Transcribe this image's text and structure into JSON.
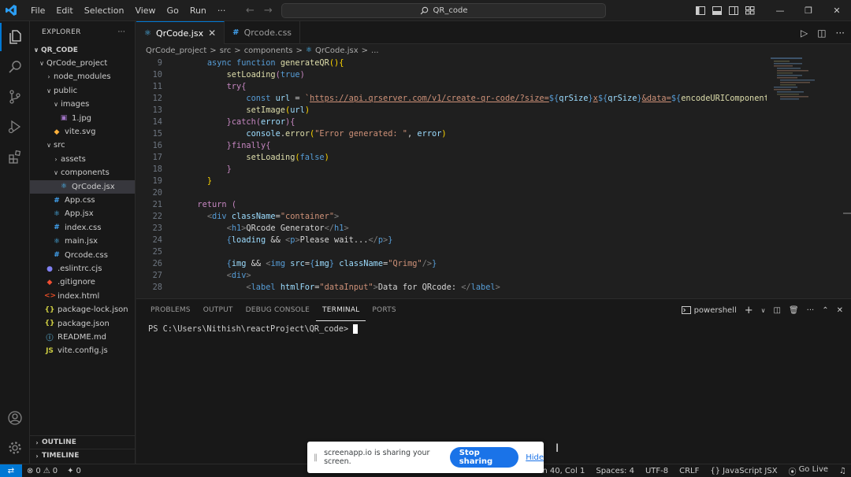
{
  "titlebar": {
    "menu": [
      "File",
      "Edit",
      "Selection",
      "View",
      "Go",
      "Run",
      "···"
    ],
    "search_text": "QR_code",
    "window_controls": [
      "minimize",
      "restore",
      "close"
    ]
  },
  "sidebar": {
    "title": "EXPLORER",
    "more": "···",
    "workspace": "QR_CODE",
    "tree": [
      {
        "label": "QrCode_project",
        "type": "folder-open",
        "indent": 1
      },
      {
        "label": "node_modules",
        "type": "folder-closed",
        "indent": 2
      },
      {
        "label": "public",
        "type": "folder-open",
        "indent": 2
      },
      {
        "label": "images",
        "type": "folder-open",
        "indent": 3
      },
      {
        "label": "1.jpg",
        "type": "image",
        "indent": 4
      },
      {
        "label": "vite.svg",
        "type": "svg",
        "indent": 3
      },
      {
        "label": "src",
        "type": "folder-open",
        "indent": 2
      },
      {
        "label": "assets",
        "type": "folder-closed",
        "indent": 3
      },
      {
        "label": "components",
        "type": "folder-open",
        "indent": 3
      },
      {
        "label": "QrCode.jsx",
        "type": "jsx",
        "indent": 4,
        "selected": true
      },
      {
        "label": "App.css",
        "type": "css",
        "indent": 3
      },
      {
        "label": "App.jsx",
        "type": "jsx",
        "indent": 3
      },
      {
        "label": "index.css",
        "type": "css",
        "indent": 3
      },
      {
        "label": "main.jsx",
        "type": "jsx",
        "indent": 3
      },
      {
        "label": "Qrcode.css",
        "type": "css",
        "indent": 3
      },
      {
        "label": ".eslintrc.cjs",
        "type": "eslint",
        "indent": 2
      },
      {
        "label": ".gitignore",
        "type": "git",
        "indent": 2
      },
      {
        "label": "index.html",
        "type": "html",
        "indent": 2
      },
      {
        "label": "package-lock.json",
        "type": "json",
        "indent": 2
      },
      {
        "label": "package.json",
        "type": "json",
        "indent": 2
      },
      {
        "label": "README.md",
        "type": "md",
        "indent": 2
      },
      {
        "label": "vite.config.js",
        "type": "js",
        "indent": 2
      }
    ],
    "outline": "OUTLINE",
    "timeline": "TIMELINE"
  },
  "tabs": [
    {
      "label": "QrCode.jsx",
      "active": true,
      "icon": "jsx"
    },
    {
      "label": "Qrcode.css",
      "active": false,
      "icon": "css"
    }
  ],
  "breadcrumb": [
    "QrCode_project",
    ">",
    "src",
    ">",
    "components",
    ">",
    "QrCode.jsx",
    ">",
    "..."
  ],
  "code": {
    "line_numbers": [
      "9",
      "10",
      "11",
      "12",
      "13",
      "14",
      "15",
      "16",
      "17",
      "18",
      "19",
      "20",
      "21",
      "22",
      "23",
      "24",
      "25",
      "26",
      "27",
      "28"
    ]
  },
  "panel": {
    "tabs": [
      "PROBLEMS",
      "OUTPUT",
      "DEBUG CONSOLE",
      "TERMINAL",
      "PORTS"
    ],
    "active_tab": "TERMINAL",
    "shell": "powershell",
    "prompt": "PS C:\\Users\\Nithish\\reactProject\\QR_code>"
  },
  "statusbar": {
    "errors": "0",
    "warnings": "0",
    "ports": "0",
    "position": "Ln 40, Col 1",
    "spaces": "Spaces: 4",
    "encoding": "UTF-8",
    "eol": "CRLF",
    "language": "JavaScript JSX",
    "golive": "Go Live"
  },
  "share": {
    "text": "screenapp.io is sharing your screen.",
    "stop_label": "Stop sharing",
    "hide_label": "Hide"
  },
  "colors": {
    "accent": "#0078d4",
    "editor_bg": "#1f1f1f",
    "sidebar_bg": "#181818",
    "share_button": "#1a73e8"
  }
}
